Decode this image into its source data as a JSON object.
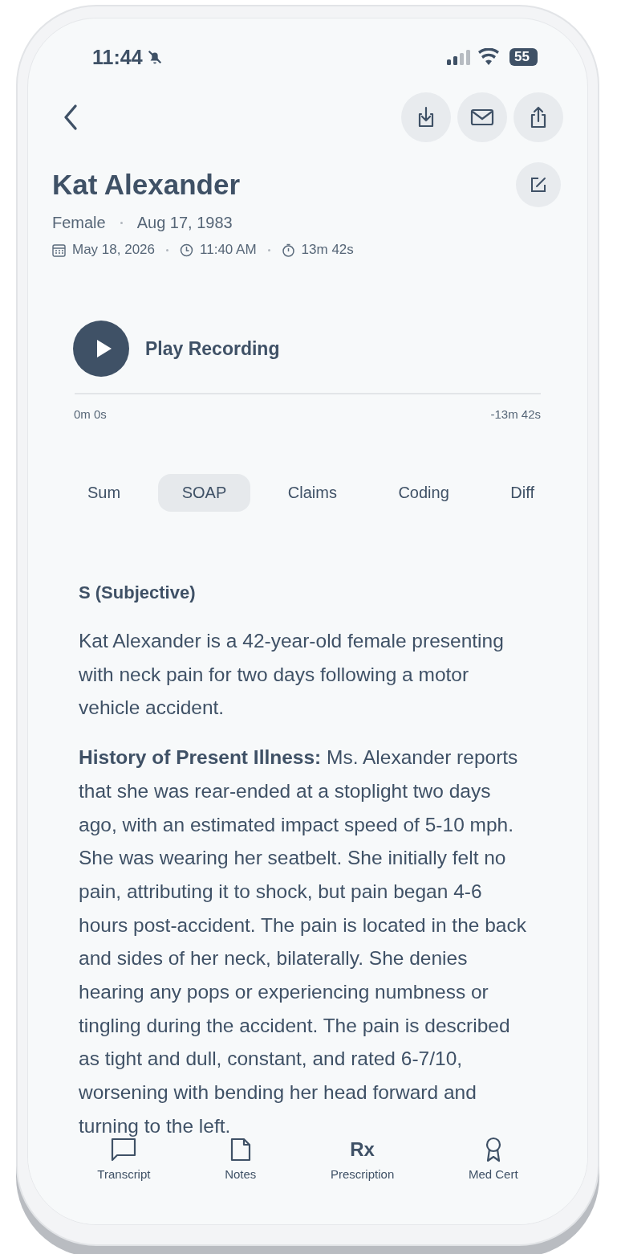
{
  "status_bar": {
    "time": "11:44",
    "silent": true,
    "battery": "55"
  },
  "header": {
    "actions": [
      {
        "kind": "download"
      },
      {
        "kind": "mail"
      },
      {
        "kind": "share"
      }
    ]
  },
  "patient": {
    "name": "Kat Alexander",
    "sex": "Female",
    "dob": "Aug 17, 1983",
    "date": "May 18, 2026",
    "time": "11:40 AM",
    "duration": "13m 42s"
  },
  "player": {
    "label": "Play Recording",
    "elapsed": "0m 0s",
    "remaining": "-13m 42s"
  },
  "tabs": [
    {
      "label": "Sum",
      "selected": false
    },
    {
      "label": "SOAP",
      "selected": true
    },
    {
      "label": "Claims",
      "selected": false
    },
    {
      "label": "Coding",
      "selected": false
    },
    {
      "label": "Diff",
      "selected": false
    }
  ],
  "note": {
    "heading": "S (Subjective)",
    "paragraphs": [
      "Kat Alexander is a 42-year-old female presenting with neck pain for two days following a motor vehicle accident.",
      "**History of Present Illness:** Ms. Alexander reports that she was rear-ended at a stoplight two days ago, with an estimated impact speed of 5-10 mph. She was wearing her seatbelt. She initially felt no pain, attributing it to shock, but pain began 4-6 hours post-accident. The pain is located in the back and sides of her neck, bilaterally. She denies hearing any pops or experiencing numbness or tingling during the accident. The pain is described as tight and dull, constant, and rated 6-7/10, worsening with bending her head forward and turning to the left."
    ]
  },
  "bottom_nav": [
    {
      "kind": "chat",
      "label": "Transcript"
    },
    {
      "kind": "note",
      "label": "Notes"
    },
    {
      "kind": "text",
      "glyph": "Rx",
      "label": "Prescription"
    },
    {
      "kind": "award",
      "label": "Med Cert"
    }
  ]
}
